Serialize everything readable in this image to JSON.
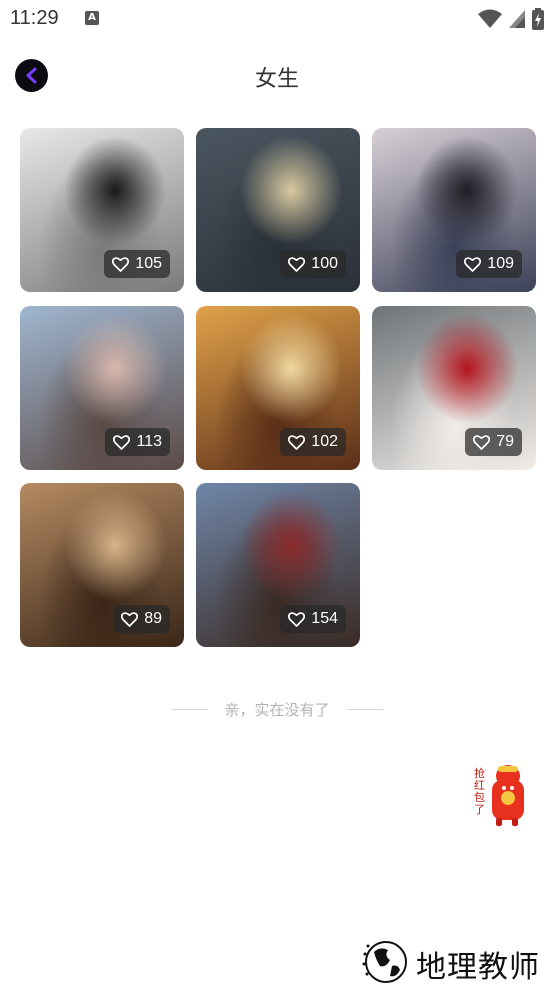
{
  "status_bar": {
    "time": "11:29",
    "icons": [
      "a-notification-icon",
      "wifi-icon",
      "signal-icon",
      "battery-charging-icon"
    ]
  },
  "header": {
    "title": "女生",
    "back_icon": "chevron-left-icon"
  },
  "photos": [
    {
      "likes": "105",
      "tone": [
        "#e8e8e8",
        "#7a7a7a",
        "#1a1a1a"
      ]
    },
    {
      "likes": "100",
      "tone": [
        "#4a5660",
        "#2a3038",
        "#d9c9a0"
      ]
    },
    {
      "likes": "109",
      "tone": [
        "#d8d0d6",
        "#3c4158",
        "#201e25"
      ]
    },
    {
      "likes": "113",
      "tone": [
        "#9fb6d0",
        "#5a4a46",
        "#d9b8ad"
      ]
    },
    {
      "likes": "102",
      "tone": [
        "#e0a24a",
        "#5a2e18",
        "#f2d9a0"
      ]
    },
    {
      "likes": "79",
      "tone": [
        "#6e7478",
        "#f1ece8",
        "#b4141c"
      ]
    },
    {
      "likes": "89",
      "tone": [
        "#b48a62",
        "#3a2618",
        "#d9b48a"
      ]
    },
    {
      "likes": "154",
      "tone": [
        "#6f86a8",
        "#3a2a24",
        "#8b2a2a"
      ]
    }
  ],
  "footer": {
    "end_text": "亲，实在没有了"
  },
  "floating": {
    "red_packet_icon": "red-packet-mascot-icon",
    "red_packet_text": "抢红包了"
  },
  "watermark": {
    "text": "地理教师",
    "logo_icon": "globe-logo-icon"
  }
}
